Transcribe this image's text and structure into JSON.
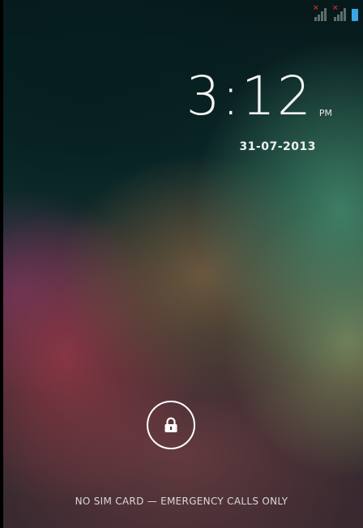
{
  "lock_screen": {
    "time": "3:12",
    "ampm": "PM",
    "date": "31-07-2013",
    "footer": "NO SIM CARD — EMERGENCY CALLS ONLY",
    "lock_icon": "padlock-icon"
  },
  "status_bar": {
    "icons": [
      "signal-no-sim-icon",
      "signal-no-sim-icon",
      "battery-icon"
    ],
    "colors": {
      "no_sim_x": "#d8262a",
      "signal": "#5d6d6a",
      "battery": "#3aa6e8"
    }
  }
}
